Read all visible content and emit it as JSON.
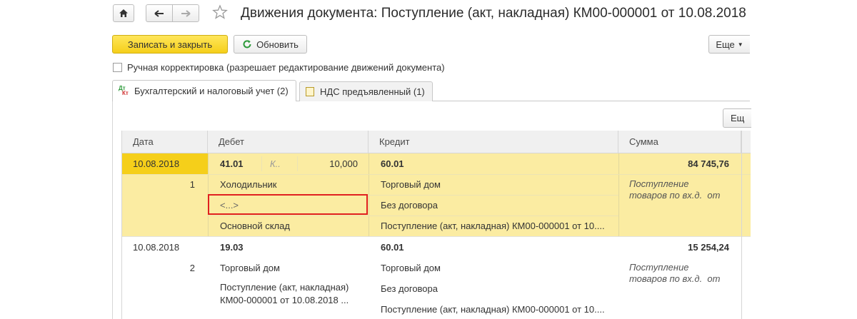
{
  "window": {
    "title": "Движения документа: Поступление (акт, накладная) КМ00-000001 от 10.08.2018"
  },
  "toolbar": {
    "save_close": "Записать и закрыть",
    "refresh": "Обновить",
    "more": "Еще",
    "more_grid": "Ещ"
  },
  "manual": {
    "label": "Ручная корректировка (разрешает редактирование движений документа)",
    "checked": false
  },
  "tabs": [
    {
      "label": "Бухгалтерский и налоговый учет (2)",
      "icon": "accounting-dt-kt-icon",
      "active": true
    },
    {
      "label": "НДС предъявленный (1)",
      "icon": "document-icon",
      "active": false
    }
  ],
  "table": {
    "headers": {
      "date": "Дата",
      "debit": "Дебет",
      "credit": "Кредит",
      "sum": "Сумма"
    },
    "rows": [
      {
        "date": "10.08.2018",
        "num": "1",
        "debit_account": "41.01",
        "debit_k": "К..",
        "debit_qty": "10,000",
        "debit_sub1": "Холодильник",
        "debit_sub2": "<...>",
        "debit_sub3": "Основной склад",
        "credit_account": "60.01",
        "credit_sub1": "Торговый дом",
        "credit_sub2": "Без договора",
        "credit_sub3": "Поступление (акт, накладная) КМ00-000001 от 10....",
        "sum": "84 745,76",
        "content_line1": "Поступление",
        "content_line2": "товаров по вх.д.  от",
        "selected": true
      },
      {
        "date": "10.08.2018",
        "num": "2",
        "debit_account": "19.03",
        "debit_sub1": "Торговый дом",
        "debit_sub2_line1": "Поступление (акт, накладная)",
        "debit_sub2_line2": "КМ00-000001 от 10.08.2018 ...",
        "credit_account": "60.01",
        "credit_sub1": "Торговый дом",
        "credit_sub2": "Без договора",
        "credit_sub3": "Поступление (акт, накладная) КМ00-000001 от 10....",
        "sum": "15 254,24",
        "content_line1": "Поступление",
        "content_line2": "товаров по вх.д.  от",
        "selected": false
      }
    ]
  },
  "colors": {
    "accent_yellow": "#f5cf1a",
    "selection": "#fbeca2",
    "highlight_box": "#e02020"
  }
}
